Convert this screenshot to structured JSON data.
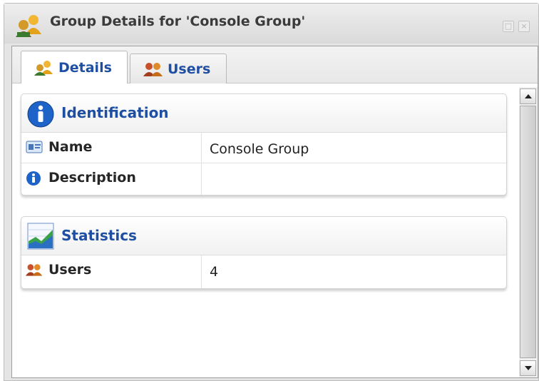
{
  "window": {
    "title": "Group Details for 'Console Group'",
    "icon": "group-icon",
    "buttons": {
      "restore_glyph": "□",
      "close_glyph": "×"
    }
  },
  "tabs": [
    {
      "label": "Details",
      "icon": "group-icon",
      "active": true
    },
    {
      "label": "Users",
      "icon": "users-icon",
      "active": false
    }
  ],
  "identification": {
    "title": "Identification",
    "icon": "info-circle-icon",
    "rows": [
      {
        "label": "Name",
        "value": "Console Group",
        "icon": "name-card-icon"
      },
      {
        "label": "Description",
        "value": "",
        "icon": "info-icon"
      }
    ]
  },
  "statistics": {
    "title": "Statistics",
    "icon": "chart-icon",
    "rows": [
      {
        "label": "Users",
        "value": "4",
        "icon": "users-icon"
      }
    ]
  },
  "colors": {
    "accent": "#1e4fa3",
    "panel_border": "#d4d4d4"
  }
}
